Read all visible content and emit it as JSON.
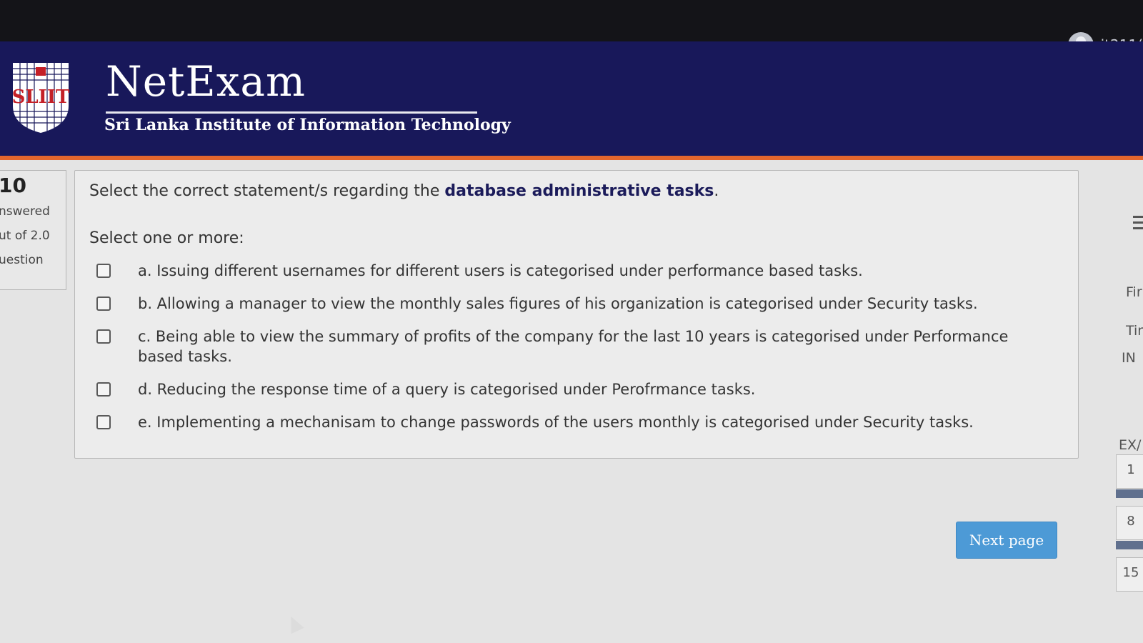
{
  "header": {
    "brand_title": "NetExam",
    "brand_subtitle": "Sri Lanka Institute of Information Technology",
    "logo_text": "SLIIT",
    "username": "it211("
  },
  "question_info": {
    "number": "10",
    "status": "nswered",
    "marks": "ut of 2.0",
    "flag_label": "uestion"
  },
  "question": {
    "text_before": "Select the correct statement/s regarding the ",
    "text_bold": "database administrative tasks",
    "text_after": ".",
    "prompt": "Select one or more:",
    "options": [
      {
        "label": "a. Issuing different usernames for different users is categorised under performance based tasks.",
        "checked": false
      },
      {
        "label": "b. Allowing a manager to view the monthly sales figures of his organization is categorised under Security tasks.",
        "checked": false
      },
      {
        "label": "c. Being able to view the summary of profits of the company for the last 10 years is categorised under Performance based tasks.",
        "checked": false
      },
      {
        "label": "d. Reducing the response time of a query is categorised under Perofrmance tasks.",
        "checked": false
      },
      {
        "label": "e. Implementing a mechanisam to change passwords of the users monthly is categorised under Security tasks.",
        "checked": false
      }
    ]
  },
  "navigation": {
    "next_label": "Next page"
  },
  "right_panel": {
    "finish_label": "Fir",
    "time_label": "Tir",
    "info_label": "IN",
    "exam_label": "EX/",
    "cells": [
      "1",
      "8",
      "15"
    ]
  },
  "colors": {
    "header_bg": "#18185a",
    "accent_strip": "#e3662d",
    "button_bg": "#4d9ad6"
  }
}
